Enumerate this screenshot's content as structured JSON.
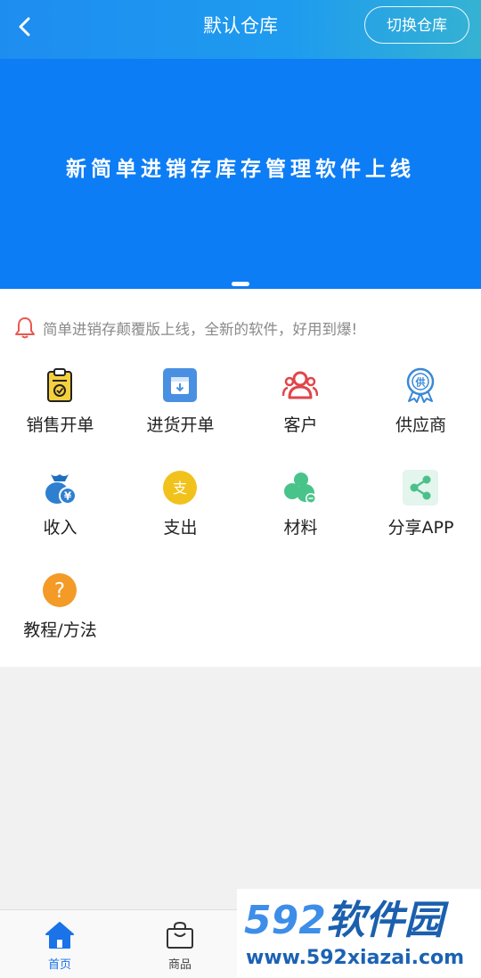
{
  "header": {
    "title": "默认仓库",
    "switch_label": "切换仓库"
  },
  "banner": {
    "text": "新简单进销存库存管理软件上线"
  },
  "notice": {
    "text": "简单进销存颠覆版上线，全新的软件，好用到爆!"
  },
  "menu": {
    "items": [
      {
        "label": "销售开单",
        "icon": "sales-clipboard-icon",
        "color": "#e8b51b"
      },
      {
        "label": "进货开单",
        "icon": "purchase-box-icon",
        "color": "#4a90e2"
      },
      {
        "label": "客户",
        "icon": "customers-icon",
        "color": "#e0464a"
      },
      {
        "label": "供应商",
        "icon": "supplier-badge-icon",
        "color": "#3a88d6"
      },
      {
        "label": "收入",
        "icon": "money-bag-icon",
        "color": "#2f7fd0"
      },
      {
        "label": "支出",
        "icon": "expense-coin-icon",
        "color": "#f2c21c"
      },
      {
        "label": "材料",
        "icon": "materials-icon",
        "color": "#48c48a"
      },
      {
        "label": "分享APP",
        "icon": "share-icon",
        "color": "#4cc08a"
      },
      {
        "label": "教程/方法",
        "icon": "help-question-icon",
        "color": "#f39a27"
      }
    ]
  },
  "icon_text": {
    "expense": "支",
    "supplier": "供",
    "yen": "¥",
    "help": "?"
  },
  "tabbar": {
    "home_label": "首页",
    "goods_label": "商品"
  },
  "watermark": {
    "brand_digits": "592",
    "brand_name": "软件园",
    "url": "www.592xiazai.com"
  },
  "colors": {
    "primary": "#1e8df0",
    "banner": "#0d7df5",
    "active_tab": "#1a73e8",
    "page_bg": "#f1f1f1"
  }
}
